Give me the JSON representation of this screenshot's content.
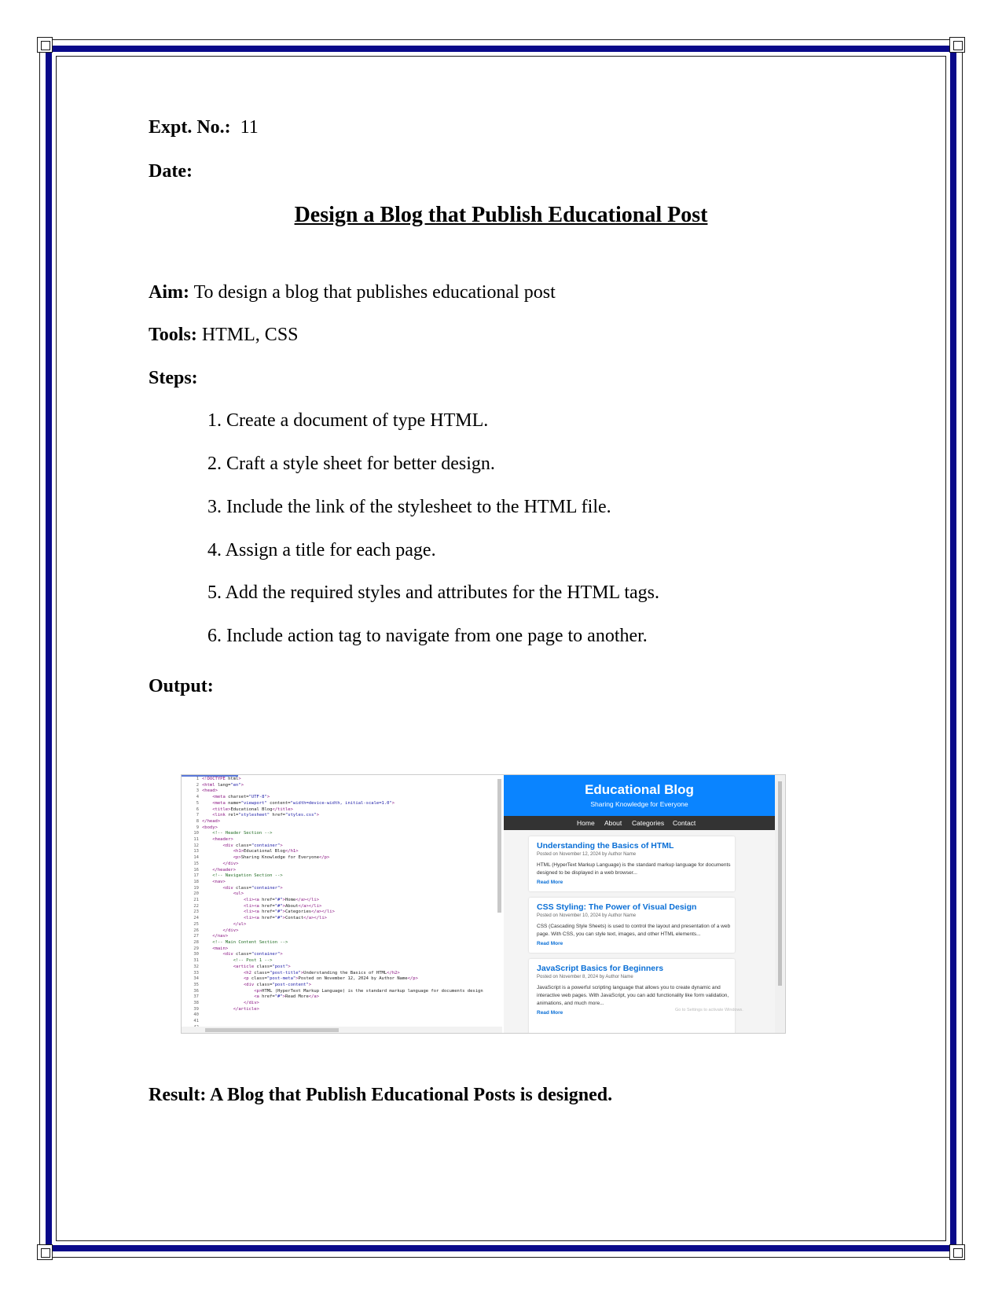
{
  "header": {
    "expt_label": "Expt. No.:",
    "expt_value": "11",
    "date_label": "Date:"
  },
  "title": "Design a Blog that Publish Educational Post",
  "aim": {
    "label": "Aim:",
    "text": "To design a blog that publishes educational post"
  },
  "tools": {
    "label": "Tools:",
    "text": "HTML, CSS"
  },
  "steps_label": "Steps:",
  "steps": [
    "1. Create a document of type HTML.",
    "2. Craft a style sheet for better design.",
    "3. Include the link of the stylesheet to the HTML file.",
    "4. Assign a title for each page.",
    "5. Add the required styles and attributes for the HTML tags.",
    "6. Include action tag to navigate from one page to another."
  ],
  "output_label": "Output:",
  "screenshot": {
    "code_lines": [
      "<!DOCTYPE html>",
      "<html lang=\"en\">",
      "<head>",
      "    <meta charset=\"UTF-8\">",
      "    <meta name=\"viewport\" content=\"width=device-width, initial-scale=1.0\">",
      "    <title>Educational Blog</title>",
      "    <link rel=\"stylesheet\" href=\"styles.css\">",
      "</head>",
      "<body>",
      "    <!-- Header Section -->",
      "    <header>",
      "        <div class=\"container\">",
      "            <h1>Educational Blog</h1>",
      "            <p>Sharing Knowledge for Everyone</p>",
      "        </div>",
      "    </header>",
      "",
      "    <!-- Navigation Section -->",
      "    <nav>",
      "        <div class=\"container\">",
      "            <ul>",
      "                <li><a href=\"#\">Home</a></li>",
      "                <li><a href=\"#\">About</a></li>",
      "                <li><a href=\"#\">Categories</a></li>",
      "                <li><a href=\"#\">Contact</a></li>",
      "            </ul>",
      "        </div>",
      "    </nav>",
      "",
      "    <!-- Main Content Section -->",
      "    <main>",
      "        <div class=\"container\">",
      "            <!-- Post 1 -->",
      "            <article class=\"post\">",
      "                <h2 class=\"post-title\">Understanding the Basics of HTML</h2>",
      "                <p class=\"post-meta\">Posted on November 12, 2024 by Author Name</p>",
      "                <div class=\"post-content\">",
      "                    <p>HTML (HyperText Markup Language) is the standard markup language for documents design",
      "                    <a href=\"#\">Read More</a>",
      "                </div>",
      "            </article>",
      ""
    ],
    "line_numbers": [
      "1",
      "2",
      "3",
      "4",
      "5",
      "6",
      "7",
      "8",
      "9",
      "10",
      "11",
      "12",
      "13",
      "14",
      "15",
      "16",
      "17",
      "18",
      "19",
      "20",
      "21",
      "22",
      "23",
      "24",
      "25",
      "26",
      "27",
      "28",
      "29",
      "30",
      "31",
      "32",
      "33",
      "34",
      "35",
      "36",
      "37",
      "38",
      "39",
      "40",
      "41",
      "42"
    ],
    "blog": {
      "title": "Educational Blog",
      "subtitle": "Sharing Knowledge for Everyone",
      "nav": [
        "Home",
        "About",
        "Categories",
        "Contact"
      ],
      "posts": [
        {
          "title": "Understanding the Basics of HTML",
          "meta": "Posted on November 12, 2024 by Author Name",
          "content": "HTML (HyperText Markup Language) is the standard markup language for documents designed to be displayed in a web browser...",
          "read_more": "Read More"
        },
        {
          "title": "CSS Styling: The Power of Visual Design",
          "meta": "Posted on November 10, 2024 by Author Name",
          "content": "CSS (Cascading Style Sheets) is used to control the layout and presentation of a web page. With CSS, you can style text, images, and other HTML elements...",
          "read_more": "Read More"
        },
        {
          "title": "JavaScript Basics for Beginners",
          "meta": "Posted on November 8, 2024 by Author Name",
          "content": "JavaScript is a powerful scripting language that allows you to create dynamic and interactive web pages. With JavaScript, you can add functionality like form validation, animations, and much more...",
          "read_more": "Read More"
        }
      ],
      "watermark": "Go to Settings to activate Windows."
    }
  },
  "result": "Result: A Blog that Publish Educational Posts is designed.",
  "colors": {
    "border": "#0a0a8a",
    "blog_header": "#0a84ff",
    "blog_nav": "#333333",
    "link": "#0a6fd6"
  }
}
